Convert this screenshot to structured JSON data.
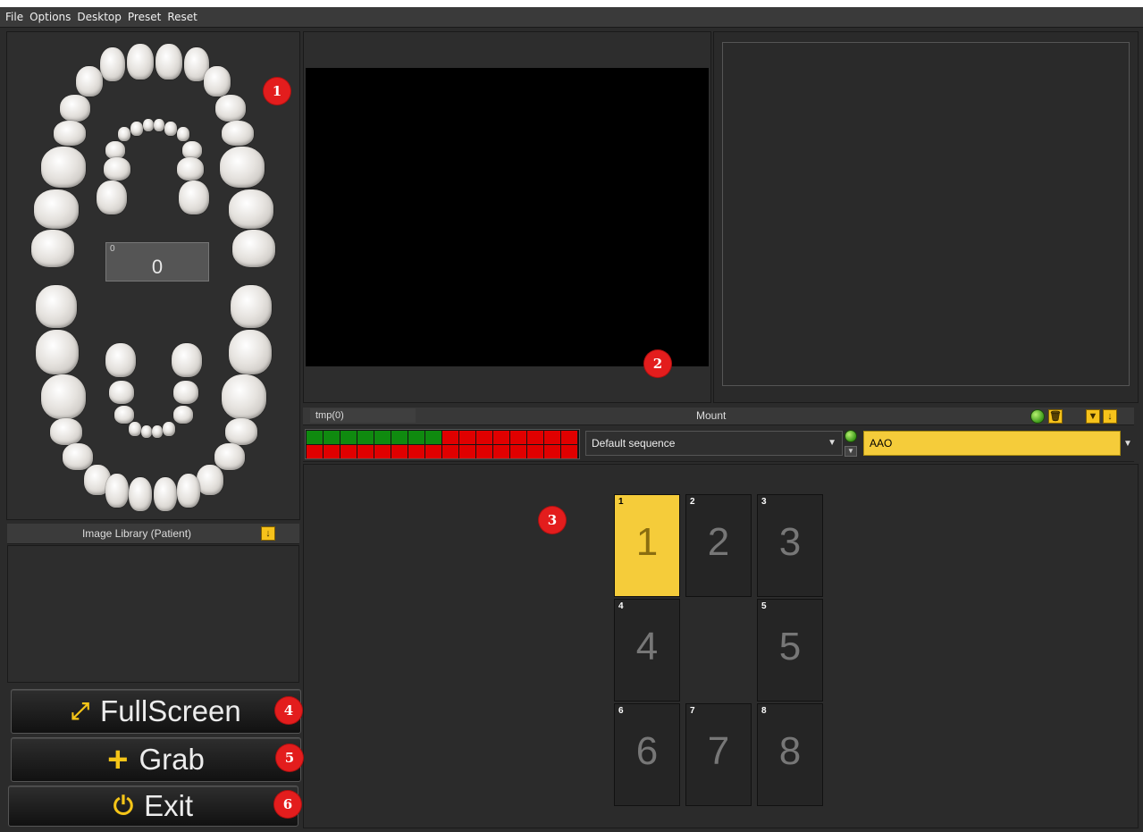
{
  "menu": [
    "File",
    "Options",
    "Desktop",
    "Preset",
    "Reset"
  ],
  "tooth_counter": {
    "small": "0",
    "value": "0"
  },
  "markers": [
    "1",
    "2",
    "3",
    "4",
    "5",
    "6"
  ],
  "image_library": {
    "title": "Image Library (Patient)"
  },
  "buttons": {
    "fullscreen": "FullScreen",
    "grab": "Grab",
    "exit": "Exit"
  },
  "mount_bar": {
    "tmp_label": "tmp(0)",
    "mount_label": "Mount"
  },
  "sequence": {
    "progress_green": 8,
    "progress_total": 16,
    "selected": "Default sequence",
    "template": "AAO"
  },
  "mount_slots": [
    {
      "small": "1",
      "big": "1",
      "active": true
    },
    {
      "small": "2",
      "big": "2",
      "active": false
    },
    {
      "small": "3",
      "big": "3",
      "active": false
    },
    {
      "small": "4",
      "big": "4",
      "active": false
    },
    {
      "small": "5",
      "big": "5",
      "active": false
    },
    {
      "small": "6",
      "big": "6",
      "active": false
    },
    {
      "small": "7",
      "big": "7",
      "active": false
    },
    {
      "small": "8",
      "big": "8",
      "active": false
    }
  ],
  "colors": {
    "accent_yellow": "#f5cc3a",
    "marker_red": "#e31d1d",
    "progress_green": "#0f8a0f",
    "progress_red": "#e00000"
  }
}
